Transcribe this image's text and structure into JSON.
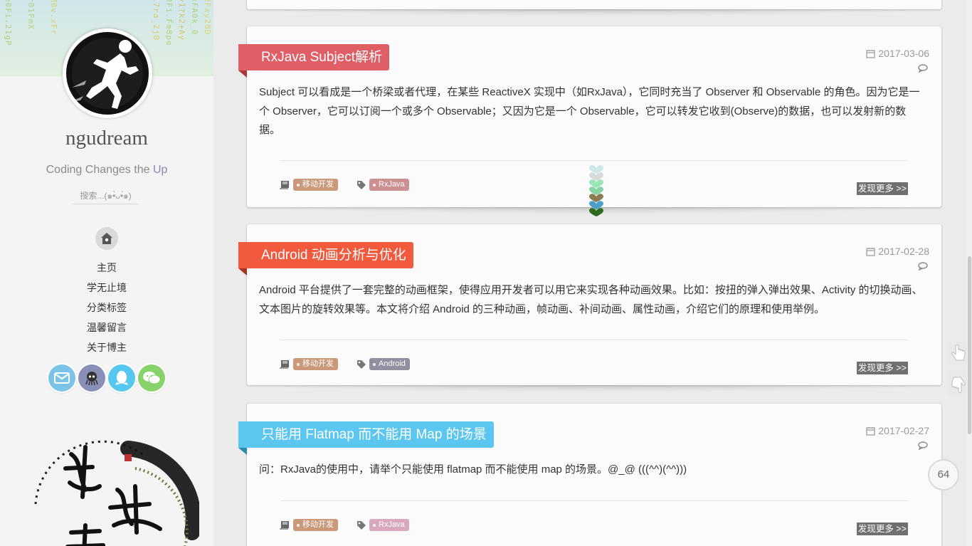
{
  "sidebar": {
    "site_name": "ngudream",
    "motto_main": "Coding Changes the ",
    "motto_accent": "Up",
    "search_placeholder": "搜索...(๑•̀ᴗ•́๑)",
    "nav": [
      "主页",
      "学无止境",
      "分类标签",
      "温馨留言",
      "关于博主"
    ],
    "social": [
      {
        "name": "email",
        "color": "#7cc3e8"
      },
      {
        "name": "github",
        "color": "#8a8fb8"
      },
      {
        "name": "qq",
        "color": "#56c7ee"
      },
      {
        "name": "wechat",
        "color": "#87d369"
      }
    ],
    "matrix_text": [
      "e0Fi.21gP",
      "r01FmX  ",
      "M0v.xFr",
      "i7ra_2jO",
      "0Fi.Fm8pe",
      "v1?k2+Ay",
      "kFA0k_0",
      "3Fxy28D"
    ]
  },
  "posts": [
    {
      "title": "RxJava Subject解析",
      "title_color": "#e05f67",
      "date": "2017-03-06",
      "excerpt": "Subject 可以看成是一个桥梁或者代理，在某些 ReactiveX 实现中（如RxJava），它同时充当了 Observer 和 Observable 的角色。因为它是一个 Observer，它可以订阅一个或多个 Observable；又因为它是一个 Observable，它可以转发它收到(Observe)的数据，也可以发射新的数据。",
      "category": "移动开发",
      "tag": "RxJava",
      "tag_color": "#cc8f92",
      "more": "发现更多 >>"
    },
    {
      "title": "Android 动画分析与优化",
      "title_color": "#f15a3d",
      "date": "2017-02-28",
      "excerpt": "Android 平台提供了一套完整的动画框架，使得应用开发者可以用它来实现各种动画效果。比如：按扭的弹入弹出效果、Activity 的切换动画、文本图片的旋转效果等。本文将介绍 Android 的三种动画，帧动画、补间动画、属性动画，介绍它们的原理和使用举例。",
      "category": "移动开发",
      "tag": "Android",
      "tag_color": "#9090a0",
      "more": "发现更多 >>"
    },
    {
      "title": "只能用 Flatmap 而不能用 Map 的场景",
      "title_color": "#5bc6ef",
      "date": "2017-02-27",
      "excerpt": "问：RxJava的使用中，请举个只能使用 flatmap 而不能使用 map 的场景。@_@ (((^^)(^^)))",
      "category": "移动开发",
      "tag": "RxJava",
      "tag_color": "#d8a8bc",
      "more": "发现更多 >>"
    }
  ],
  "category_color": "#c9997a",
  "read_count": "64",
  "hearts": [
    "#cfe7e7",
    "#d9d9d9",
    "#9be3b8",
    "#86d3a4",
    "#8b7d4f",
    "#4aa0c9",
    "#2d6b1e"
  ]
}
